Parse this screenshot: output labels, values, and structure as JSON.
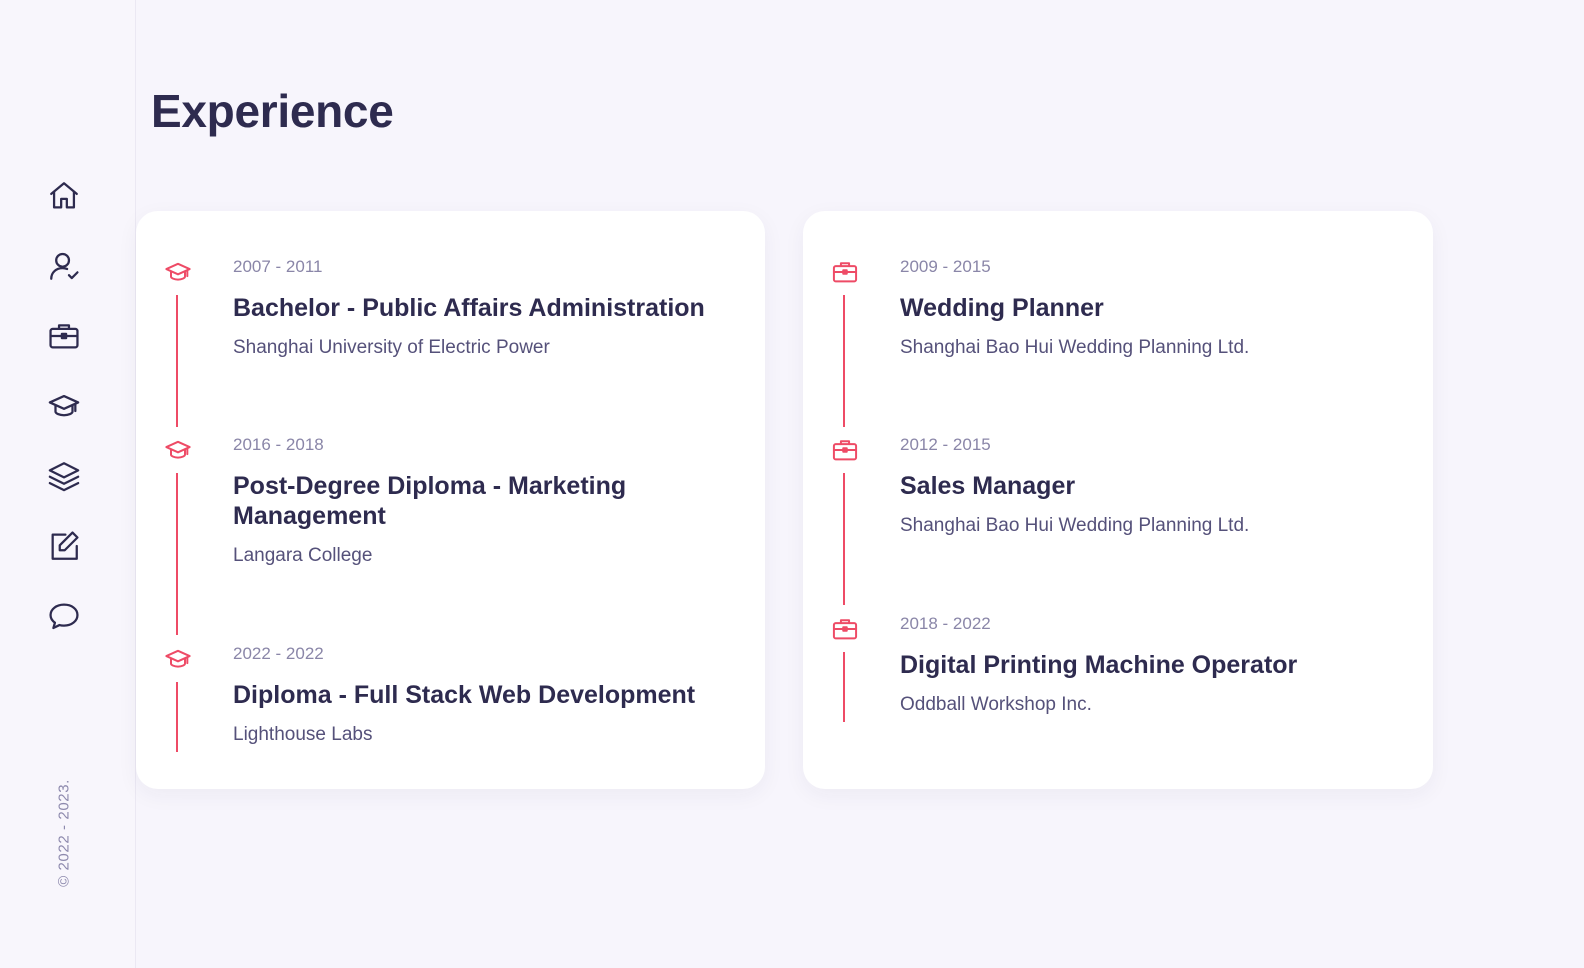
{
  "page": {
    "title": "Experience"
  },
  "sidebar": {
    "items": [
      {
        "name": "home",
        "icon": "home-icon"
      },
      {
        "name": "about",
        "icon": "user-check-icon"
      },
      {
        "name": "experience",
        "icon": "briefcase-icon"
      },
      {
        "name": "education",
        "icon": "graduation-cap-icon"
      },
      {
        "name": "portfolio",
        "icon": "layers-icon"
      },
      {
        "name": "blog",
        "icon": "edit-icon"
      },
      {
        "name": "contact",
        "icon": "chat-bubble-icon"
      }
    ],
    "copyright": "© 2022 - 2023."
  },
  "colors": {
    "accent": "#ee4b66",
    "text": "#2e2b4f",
    "muted": "#8a86a8",
    "background": "#f7f5fc",
    "card": "#ffffff"
  },
  "education": [
    {
      "period": "2007 - 2011",
      "title": "Bachelor - Public Affairs Administration",
      "org": "Shanghai University of Electric Power",
      "icon": "graduation-cap-icon"
    },
    {
      "period": "2016 - 2018",
      "title": "Post-Degree Diploma - Marketing Management",
      "org": "Langara College",
      "icon": "graduation-cap-icon"
    },
    {
      "period": "2022 - 2022",
      "title": "Diploma - Full Stack Web Development",
      "org": "Lighthouse Labs",
      "icon": "graduation-cap-icon"
    }
  ],
  "work": [
    {
      "period": "2009 - 2015",
      "title": "Wedding Planner",
      "org": "Shanghai Bao Hui Wedding Planning Ltd.",
      "icon": "briefcase-icon"
    },
    {
      "period": "2012 - 2015",
      "title": "Sales Manager",
      "org": "Shanghai Bao Hui Wedding Planning Ltd.",
      "icon": "briefcase-icon"
    },
    {
      "period": "2018 - 2022",
      "title": "Digital Printing Machine Operator",
      "org": "Oddball Workshop Inc.",
      "icon": "briefcase-icon"
    }
  ]
}
